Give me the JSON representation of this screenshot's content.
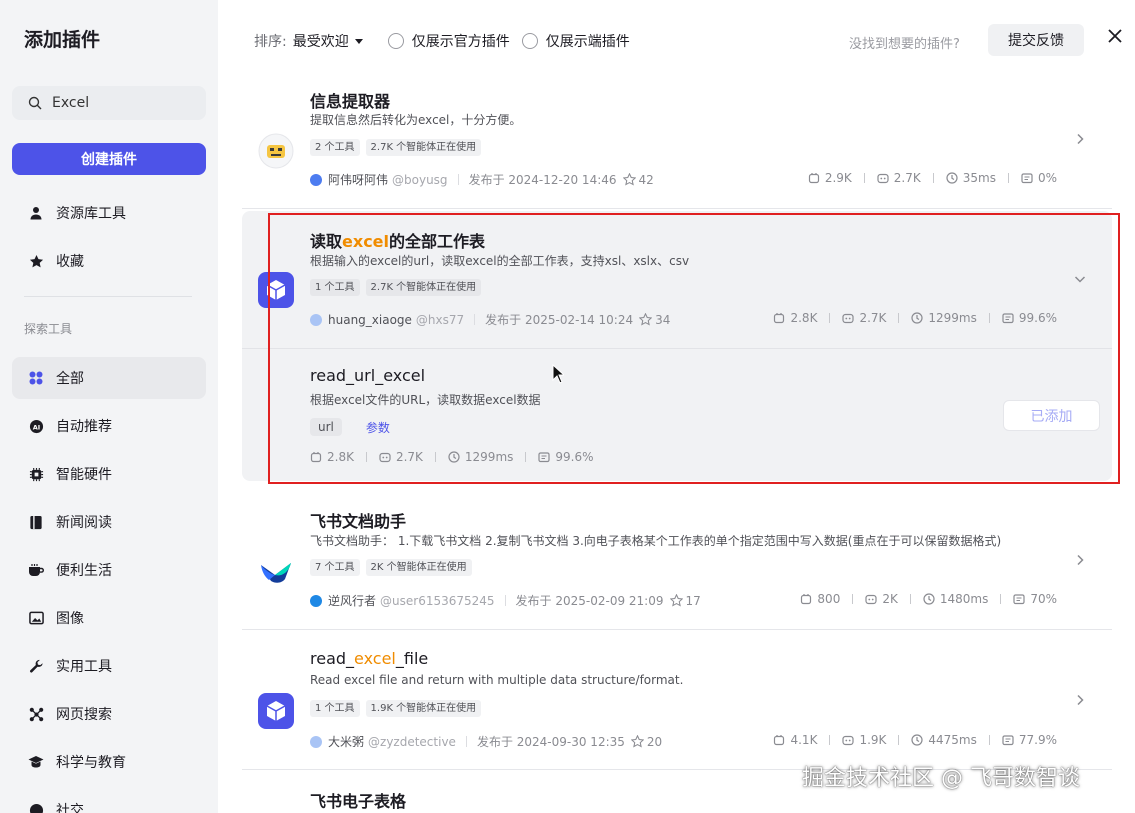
{
  "dialog": {
    "title": "添加插件",
    "search_value": "Excel",
    "create_button": "创建插件",
    "nav_top": [
      {
        "label": "资源库工具",
        "icon": "person-icon"
      },
      {
        "label": "收藏",
        "icon": "star-icon"
      }
    ],
    "section_label": "探索工具",
    "nav_categories": [
      {
        "label": "全部",
        "icon": "grid-icon",
        "active": true
      },
      {
        "label": "自动推荐",
        "icon": "ai-icon"
      },
      {
        "label": "智能硬件",
        "icon": "chip-icon"
      },
      {
        "label": "新闻阅读",
        "icon": "book-icon"
      },
      {
        "label": "便利生活",
        "icon": "cup-icon"
      },
      {
        "label": "图像",
        "icon": "image-icon"
      },
      {
        "label": "实用工具",
        "icon": "wrench-icon"
      },
      {
        "label": "网页搜索",
        "icon": "network-icon"
      },
      {
        "label": "科学与教育",
        "icon": "graduation-cap-icon"
      },
      {
        "label": "社交",
        "icon": "chat-icon"
      }
    ]
  },
  "toolbar": {
    "sort_label": "排序:",
    "sort_value": "最受欢迎",
    "filter_official": "仅展示官方插件",
    "filter_client": "仅展示端插件",
    "not_found": "没找到想要的插件?",
    "feedback": "提交反馈"
  },
  "plugins": [
    {
      "title": "信息提取器",
      "desc": "提取信息然后转化为excel，十分方便。",
      "tags": [
        "2 个工具",
        "2.7K 个智能体正在使用"
      ],
      "author": "阿伟呀阿伟",
      "handle": "@boyusg",
      "published": "发布于 2024-12-20 14:46",
      "stars": "42",
      "stats": [
        "2.9K",
        "2.7K",
        "35ms",
        "0%"
      ]
    },
    {
      "title_pre": "读取",
      "title_hl": "excel",
      "title_post": "的全部工作表",
      "desc": "根据输入的excel的url，读取excel的全部工作表，支持xsl、xslx、csv",
      "tags": [
        "1 个工具",
        "2.7K 个智能体正在使用"
      ],
      "author": "huang_xiaoge",
      "handle": "@hxs77",
      "published": "发布于 2025-02-14 10:24",
      "stars": "34",
      "stats": [
        "2.8K",
        "2.7K",
        "1299ms",
        "99.6%"
      ],
      "tool": {
        "name": "read_url_excel",
        "desc": "根据excel文件的URL，读取数据excel数据",
        "param": "url",
        "param_link": "参数",
        "stats": [
          "2.8K",
          "2.7K",
          "1299ms",
          "99.6%"
        ],
        "added": "已添加"
      }
    },
    {
      "title": "飞书文档助手",
      "desc": "飞书文档助手： 1.下载飞书文档 2.复制飞书文档 3.向电子表格某个工作表的单个指定范围中写入数据(重点在于可以保留数据格式)",
      "tags": [
        "7 个工具",
        "2K 个智能体正在使用"
      ],
      "author": "逆风行者",
      "handle": "@user6153675245",
      "published": "发布于 2025-02-09 21:09",
      "stars": "17",
      "stats": [
        "800",
        "2K",
        "1480ms",
        "70%"
      ]
    },
    {
      "title_pre": "read_",
      "title_hl": "excel",
      "title_post": "_file",
      "desc": "Read excel file and return with multiple data structure/format.",
      "tags": [
        "1 个工具",
        "1.9K 个智能体正在使用"
      ],
      "author": "大米粥",
      "handle": "@zyzdetective",
      "published": "发布于 2024-09-30 12:35",
      "stars": "20",
      "stats": [
        "4.1K",
        "1.9K",
        "4475ms",
        "77.9%"
      ]
    },
    {
      "title": "飞书电子表格"
    }
  ],
  "watermark": "掘金技术社区 @ 飞哥数智谈"
}
